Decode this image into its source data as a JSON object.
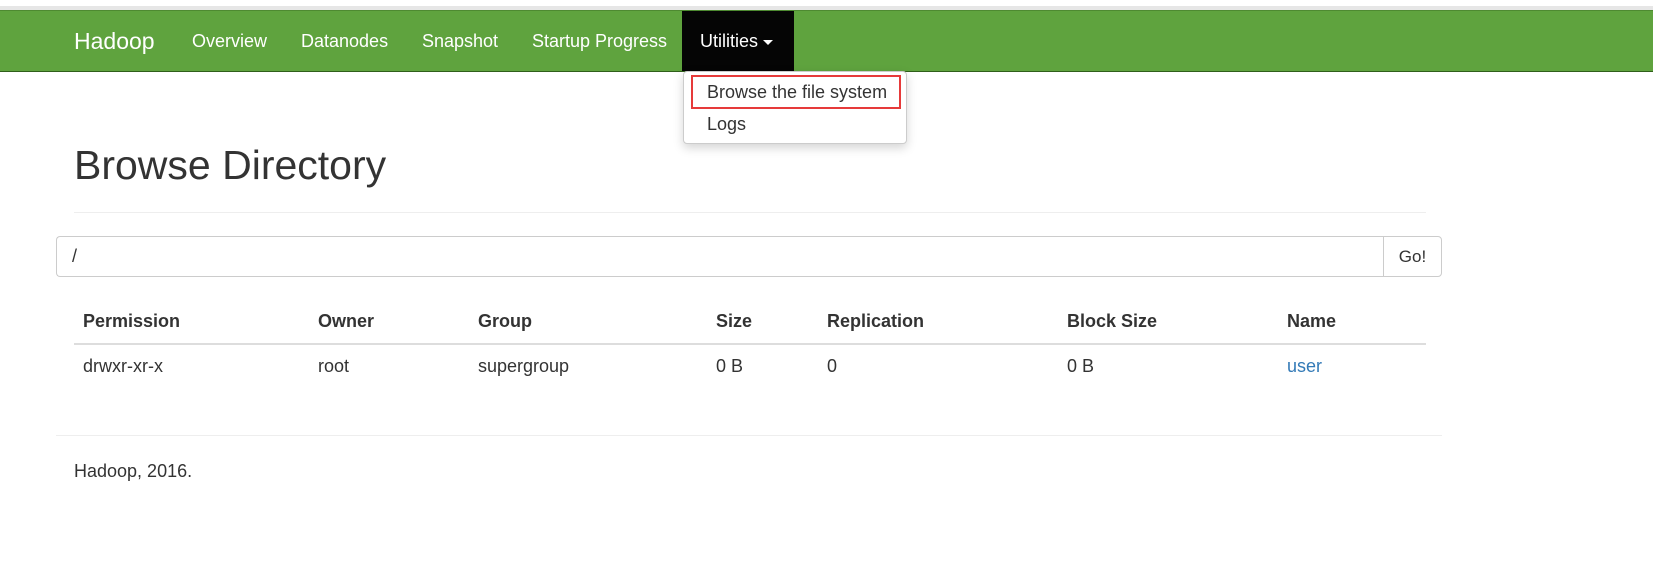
{
  "navbar": {
    "brand": "Hadoop",
    "items": [
      {
        "label": "Overview"
      },
      {
        "label": "Datanodes"
      },
      {
        "label": "Snapshot"
      },
      {
        "label": "Startup Progress"
      },
      {
        "label": "Utilities"
      }
    ],
    "active_item": "Utilities",
    "color": "#5fa33e",
    "active_color": "#050505"
  },
  "dropdown": {
    "items": [
      {
        "label": "Browse the file system",
        "highlighted": true
      },
      {
        "label": "Logs"
      }
    ],
    "highlight_color": "#e63a3a"
  },
  "page": {
    "title": "Browse Directory"
  },
  "path_bar": {
    "value": "/",
    "go_label": "Go!"
  },
  "table": {
    "columns": [
      "Permission",
      "Owner",
      "Group",
      "Size",
      "Replication",
      "Block Size",
      "Name"
    ],
    "rows": [
      [
        "drwxr-xr-x",
        "root",
        "supergroup",
        "0 B",
        "0",
        "0 B",
        "user"
      ]
    ],
    "link_color": "#337ab7"
  },
  "footer": {
    "text": "Hadoop, 2016."
  }
}
